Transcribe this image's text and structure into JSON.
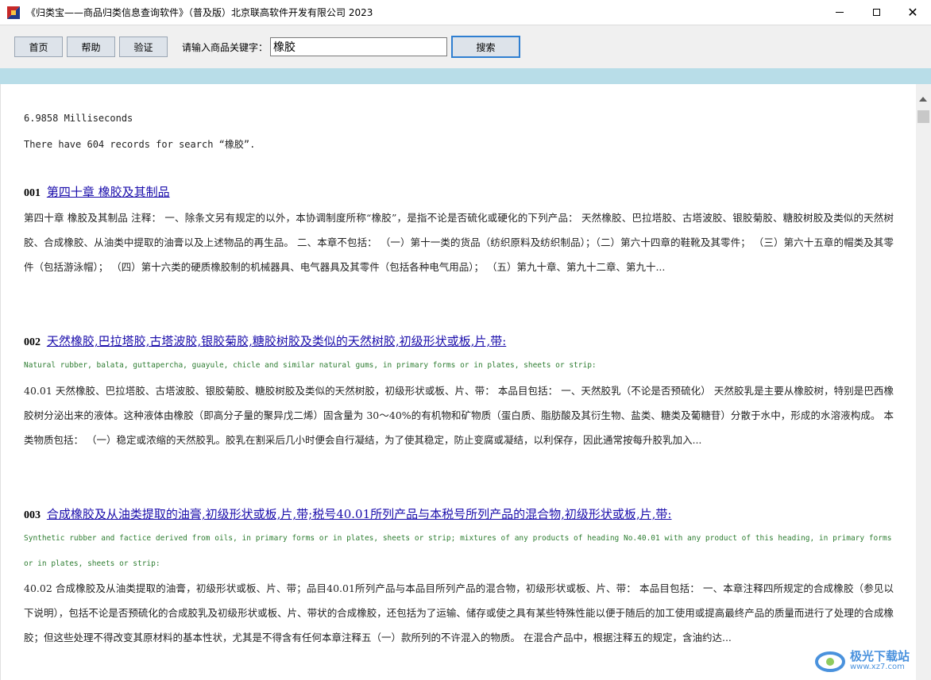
{
  "window": {
    "title": "《归类宝——商品归类信息查询软件》（普及版）北京联高软件开发有限公司 2023",
    "minimize_icon": "minimize-icon",
    "maximize_icon": "maximize-icon",
    "close_glyph": "✕"
  },
  "toolbar": {
    "home_label": "首页",
    "help_label": "帮助",
    "verify_label": "验证",
    "keyword_label": "请输入商品关键字：",
    "keyword_value": "橡胶",
    "search_label": "搜索"
  },
  "results": {
    "timing": "6.9858 Milliseconds",
    "summary": "There have 604 records for search “橡胶”.",
    "records": [
      {
        "num": "001",
        "title": "第四十章 橡胶及其制品",
        "english": "",
        "body": "第四十章 橡胶及其制品 注释： 一、除条文另有规定的以外，本协调制度所称“橡胶”，是指不论是否硫化或硬化的下列产品： 天然橡胶、巴拉塔胶、古塔波胶、银胶菊胶、糖胶树胶及类似的天然树胶、合成橡胶、从油类中提取的油膏以及上述物品的再生品。 二、本章不包括： （一）第十一类的货品（纺织原料及纺织制品）；（二）第六十四章的鞋靴及其零件； （三）第六十五章的帽类及其零件（包括游泳帽）； （四）第十六类的硬质橡胶制的机械器具、电气器具及其零件（包括各种电气用品）； （五）第九十章、第九十二章、第九十..."
      },
      {
        "num": "002",
        "title": "天然橡胶,巴拉塔胶,古塔波胶,银胶菊胶,糖胶树胶及类似的天然树胶,初级形状或板,片,带:",
        "english": "Natural rubber, balata, guttapercha, guayule, chicle and similar natural gums, in primary forms or in plates, sheets or strip:",
        "body": "40.01 天然橡胶、巴拉塔胶、古塔波胶、银胶菊胶、糖胶树胶及类似的天然树胶，初级形状或板、片、带： 本品目包括： 一、天然胶乳（不论是否预硫化） 天然胶乳是主要从橡胶树，特别是巴西橡胶树分泌出来的液体。这种液体由橡胶（即高分子量的聚异戊二烯）固含量为 30～40%的有机物和矿物质（蛋白质、脂肪酸及其衍生物、盐类、糖类及葡糖苷）分散于水中，形成的水溶液构成。 本类物质包括： （一）稳定或浓缩的天然胶乳。胶乳在割采后几小时便会自行凝结，为了使其稳定，防止变腐或凝结，以利保存，因此通常按每升胶乳加入..."
      },
      {
        "num": "003",
        "title": "合成橡胶及从油类提取的油膏,初级形状或板,片,带;税号40.01所列产品与本税号所列产品的混合物,初级形状或板,片,带:",
        "english": "Synthetic rubber and factice derived from oils, in primary forms or in plates, sheets or strip; mixtures of any products of heading No.40.01 with any product of this heading, in primary forms or in plates, sheets or strip:",
        "body": "40.02 合成橡胶及从油类提取的油膏，初级形状或板、片、带；品目40.01所列产品与本品目所列产品的混合物，初级形状或板、片、带： 本品目包括： 一、本章注释四所规定的合成橡胶（参见以下说明），包括不论是否预硫化的合成胶乳及初级形状或板、片、带状的合成橡胶，还包括为了运输、储存或使之具有某些特殊性能以便于随后的加工使用或提高最终产品的质量而进行了处理的合成橡胶；但这些处理不得改变其原材料的基本性状，尤其是不得含有任何本章注释五（一）款所列的不许混入的物质。 在混合产品中，根据注释五的规定，含油约达..."
      }
    ]
  },
  "watermark": {
    "brand": "极光下载站",
    "url": "www.xz7.com"
  }
}
